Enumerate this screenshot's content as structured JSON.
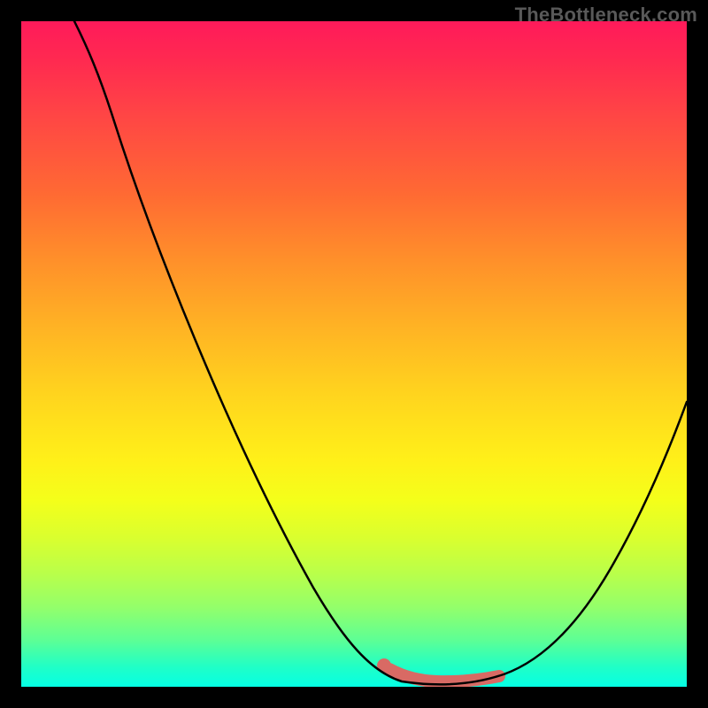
{
  "watermark": "TheBottleneck.com",
  "chart_data": {
    "type": "line",
    "title": "",
    "xlabel": "",
    "ylabel": "",
    "xlim": [
      0,
      100
    ],
    "ylim": [
      0,
      100
    ],
    "grid": false,
    "legend": false,
    "background": "vertical-gradient red->yellow->green (bottleneck severity scale)",
    "series": [
      {
        "name": "bottleneck-curve",
        "x": [
          8,
          12,
          16,
          20,
          24,
          28,
          32,
          36,
          40,
          44,
          48,
          52,
          55,
          58,
          61,
          64,
          68,
          72,
          76,
          80,
          84,
          88,
          92,
          96,
          100
        ],
        "y": [
          100,
          92,
          84,
          76,
          68,
          60,
          52,
          44,
          36,
          28,
          20,
          13,
          8,
          4,
          2,
          1,
          1,
          1,
          3,
          7,
          14,
          23,
          33,
          44,
          56
        ]
      }
    ],
    "annotations": [
      {
        "name": "optimal-range-highlight",
        "type": "segment",
        "color": "#d86a64",
        "x": [
          54,
          72
        ],
        "y": [
          3.5,
          1.0
        ]
      },
      {
        "name": "optimal-dot",
        "type": "point",
        "color": "#d86a64",
        "x": 55,
        "y": 4
      }
    ]
  }
}
